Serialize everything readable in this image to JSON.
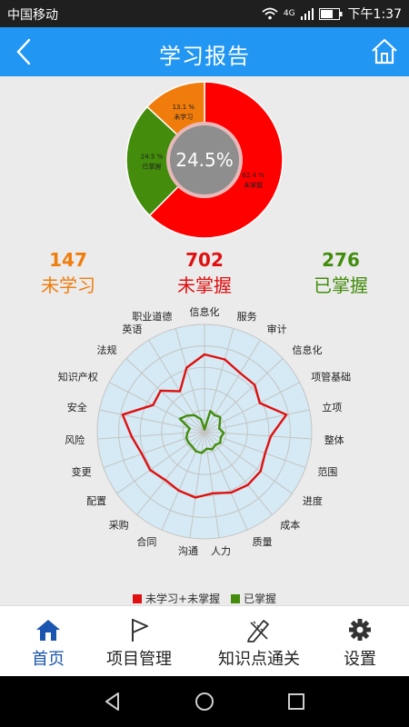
{
  "status_bar": {
    "carrier": "中国移动",
    "network": "4G",
    "time": "下午1:37"
  },
  "app_bar": {
    "title": "学习报告",
    "back_icon": "back-icon",
    "home_icon": "home-icon"
  },
  "donut": {
    "center_text": "24.5%",
    "slices": [
      {
        "name": "未掌握",
        "percent_label": "62.4 %",
        "value": 62.4,
        "color": "#ff0000"
      },
      {
        "name": "已掌握",
        "percent_label": "24.5 %",
        "value": 24.5,
        "color": "#438c0c"
      },
      {
        "name": "未学习",
        "percent_label": "13.1 %",
        "value": 13.1,
        "color": "#f07c0c"
      }
    ]
  },
  "stats": [
    {
      "value": "147",
      "label": "未学习",
      "color": "#f07c0c"
    },
    {
      "value": "702",
      "label": "未掌握",
      "color": "#e01010"
    },
    {
      "value": "276",
      "label": "已掌握",
      "color": "#438c0c"
    }
  ],
  "chart_data": {
    "type": "radar",
    "categories": [
      "信息化",
      "服务",
      "审计",
      "信息化",
      "项管基础",
      "立项",
      "整体",
      "范围",
      "进度",
      "成本",
      "质量",
      "人力",
      "沟通",
      "合同",
      "采购",
      "配置",
      "变更",
      "风险",
      "安全",
      "知识产权",
      "法规",
      "英语",
      "职业道德"
    ],
    "series": [
      {
        "name": "未学习+未掌握",
        "color": "#e01010",
        "values": [
          0.72,
          0.7,
          0.64,
          0.64,
          0.58,
          0.78,
          0.62,
          0.6,
          0.64,
          0.64,
          0.62,
          0.58,
          0.62,
          0.6,
          0.58,
          0.62,
          0.62,
          0.68,
          0.78,
          0.54,
          0.56,
          0.44,
          0.62
        ]
      },
      {
        "name": "已掌握",
        "color": "#438c0c",
        "values": [
          0.02,
          0.2,
          0.18,
          0.2,
          0.16,
          0.14,
          0.18,
          0.16,
          0.18,
          0.16,
          0.18,
          0.16,
          0.2,
          0.2,
          0.18,
          0.18,
          0.18,
          0.16,
          0.14,
          0.26,
          0.22,
          0.18,
          0.12
        ]
      }
    ],
    "grid_levels": 5,
    "legend": "bottom"
  },
  "bottom_nav": [
    {
      "label": "首页",
      "icon": "home-icon",
      "active": true
    },
    {
      "label": "项目管理",
      "icon": "flag-icon",
      "active": false
    },
    {
      "label": "知识点通关",
      "icon": "pencil-ruler-icon",
      "active": false
    },
    {
      "label": "设置",
      "icon": "gear-icon",
      "active": false
    }
  ],
  "system_nav": [
    "back-triangle-icon",
    "home-circle-icon",
    "recents-square-icon"
  ]
}
